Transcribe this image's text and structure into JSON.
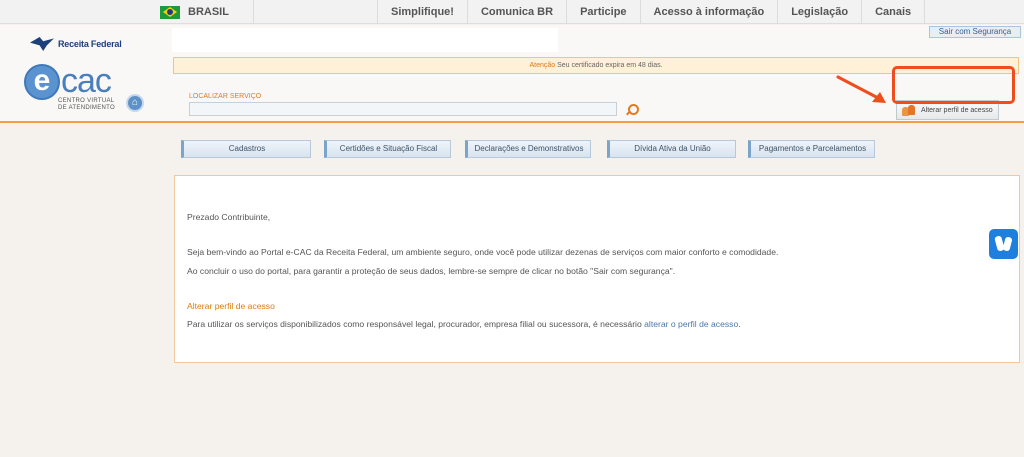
{
  "govbar": {
    "country": "BRASIL",
    "links": [
      "Simplifique!",
      "Comunica BR",
      "Participe",
      "Acesso à informação",
      "Legislação",
      "Canais"
    ]
  },
  "header": {
    "brand": "Receita Federal",
    "ecac_e": "e",
    "ecac_cac": "cac",
    "ecac_tagline_1": "CENTRO VIRTUAL",
    "ecac_tagline_2": "DE ATENDIMENTO",
    "logout_label": "Sair com Segurança",
    "alert_prefix": "Atenção",
    "alert_text": " Seu certificado expira em 48 dias.",
    "search_label": "LOCALIZAR SERVIÇO",
    "search_value": "",
    "profile_button": "Alterar perfil de acesso"
  },
  "menu": [
    "Cadastros",
    "Certidões e Situação Fiscal",
    "Declarações e Demonstrativos",
    "Dívida Ativa da União",
    "Pagamentos e Parcelamentos"
  ],
  "content": {
    "greeting": "Prezado Contribuinte,",
    "welcome": "Seja bem-vindo ao Portal e-CAC da Receita Federal, um ambiente seguro, onde você pode utilizar dezenas de serviços com maior conforto e comodidade.",
    "logout_tip": "Ao concluir o uso do portal, para garantir a proteção de seus dados, lembre-se sempre de clicar no botão \"Sair com segurança\".",
    "profile_heading": "Alterar perfil de acesso",
    "profile_text": "Para utilizar os serviços disponibilizados como responsável legal, procurador, empresa filial ou sucessora, é necessário ",
    "profile_link": "alterar o perfil de acesso",
    "profile_end": "."
  },
  "colors": {
    "accent": "#e07a10",
    "highlight": "#ef4e1c",
    "link": "#4a78ab"
  },
  "icons": [
    "brazil-flag-icon",
    "eagle-icon",
    "home-icon",
    "search-icon",
    "people-icon",
    "accessibility-hands-icon",
    "arrow-icon"
  ]
}
